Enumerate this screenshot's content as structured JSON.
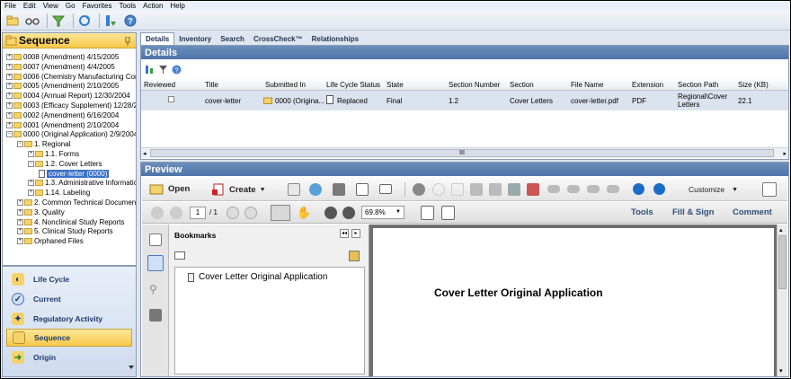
{
  "menu": [
    "File",
    "Edit",
    "View",
    "Go",
    "Favorites",
    "Tools",
    "Action",
    "Help"
  ],
  "sequence": {
    "title": "Sequence",
    "tree": [
      {
        "label": "0008 (Amendment) 4/15/2005",
        "depth": 0
      },
      {
        "label": "0007 (Amendment) 4/4/2005",
        "depth": 0
      },
      {
        "label": "0006 (Chemistry Manufacturing Contr",
        "depth": 0
      },
      {
        "label": "0005 (Amendment) 2/10/2005",
        "depth": 0
      },
      {
        "label": "0004 (Annual Report) 12/30/2004",
        "depth": 0
      },
      {
        "label": "0003 (Efficacy Supplement) 12/28/2",
        "depth": 0
      },
      {
        "label": "0002 (Amendment) 6/16/2004",
        "depth": 0
      },
      {
        "label": "0001 (Amendment) 2/10/2004",
        "depth": 0
      },
      {
        "label": "0000 (Original Application) 2/9/2004",
        "depth": 0
      },
      {
        "label": "1. Regional",
        "depth": 1
      },
      {
        "label": "1.1. Forms",
        "depth": 2
      },
      {
        "label": "1.2. Cover Letters",
        "depth": 2
      },
      {
        "label": "cover-letter (0000)",
        "depth": 3
      },
      {
        "label": "1.3. Administrative Informatic",
        "depth": 2
      },
      {
        "label": "1.14. Labeling",
        "depth": 2
      },
      {
        "label": "2. Common Technical Documen",
        "depth": 1
      },
      {
        "label": "3. Quality",
        "depth": 1
      },
      {
        "label": "4. Nonclinical Study Reports",
        "depth": 1
      },
      {
        "label": "5. Clinical Study Reports",
        "depth": 1
      },
      {
        "label": "Orphaned Files",
        "depth": 1
      }
    ]
  },
  "nav": [
    {
      "label": "Life Cycle"
    },
    {
      "label": "Current"
    },
    {
      "label": "Regulatory Activity"
    },
    {
      "label": "Sequence"
    },
    {
      "label": "Origin"
    }
  ],
  "tabs": [
    "Details",
    "Inventory",
    "Search",
    "CrossCheck™",
    "Relationships"
  ],
  "details": {
    "title": "Details",
    "columns": [
      "Reviewed",
      "Title",
      "Submitted In",
      "Life Cycle Status",
      "State",
      "Section Number",
      "Section",
      "File Name",
      "Extension",
      "Section Path",
      "Size (KB)"
    ],
    "row": {
      "title": "cover-letter",
      "submitted_in": "0000 (Origina...",
      "status": "Replaced",
      "state": "Final",
      "section_number": "1.2",
      "section": "Cover Letters",
      "file_name": "cover-letter.pdf",
      "extension": "PDF",
      "section_path_1": "Regional\\Cover",
      "section_path_2": "Letters",
      "size": "22.1"
    },
    "scroll_marker": "III"
  },
  "preview": {
    "title": "Preview",
    "open_label": "Open",
    "create_label": "Create",
    "customize_label": "Customize",
    "page_current": "1",
    "page_total": "/ 1",
    "zoom": "69.8%",
    "tools_label": "Tools",
    "fill_sign_label": "Fill & Sign",
    "comment_label": "Comment",
    "bookmarks_label": "Bookmarks",
    "bookmark_item": "Cover Letter Original Application",
    "page_heading": "Cover Letter Original Application"
  },
  "colors": {
    "accent_blue": "#4e74a8",
    "sequence_yellow": "#f7c84a",
    "selection_blue": "#3a70c8"
  }
}
